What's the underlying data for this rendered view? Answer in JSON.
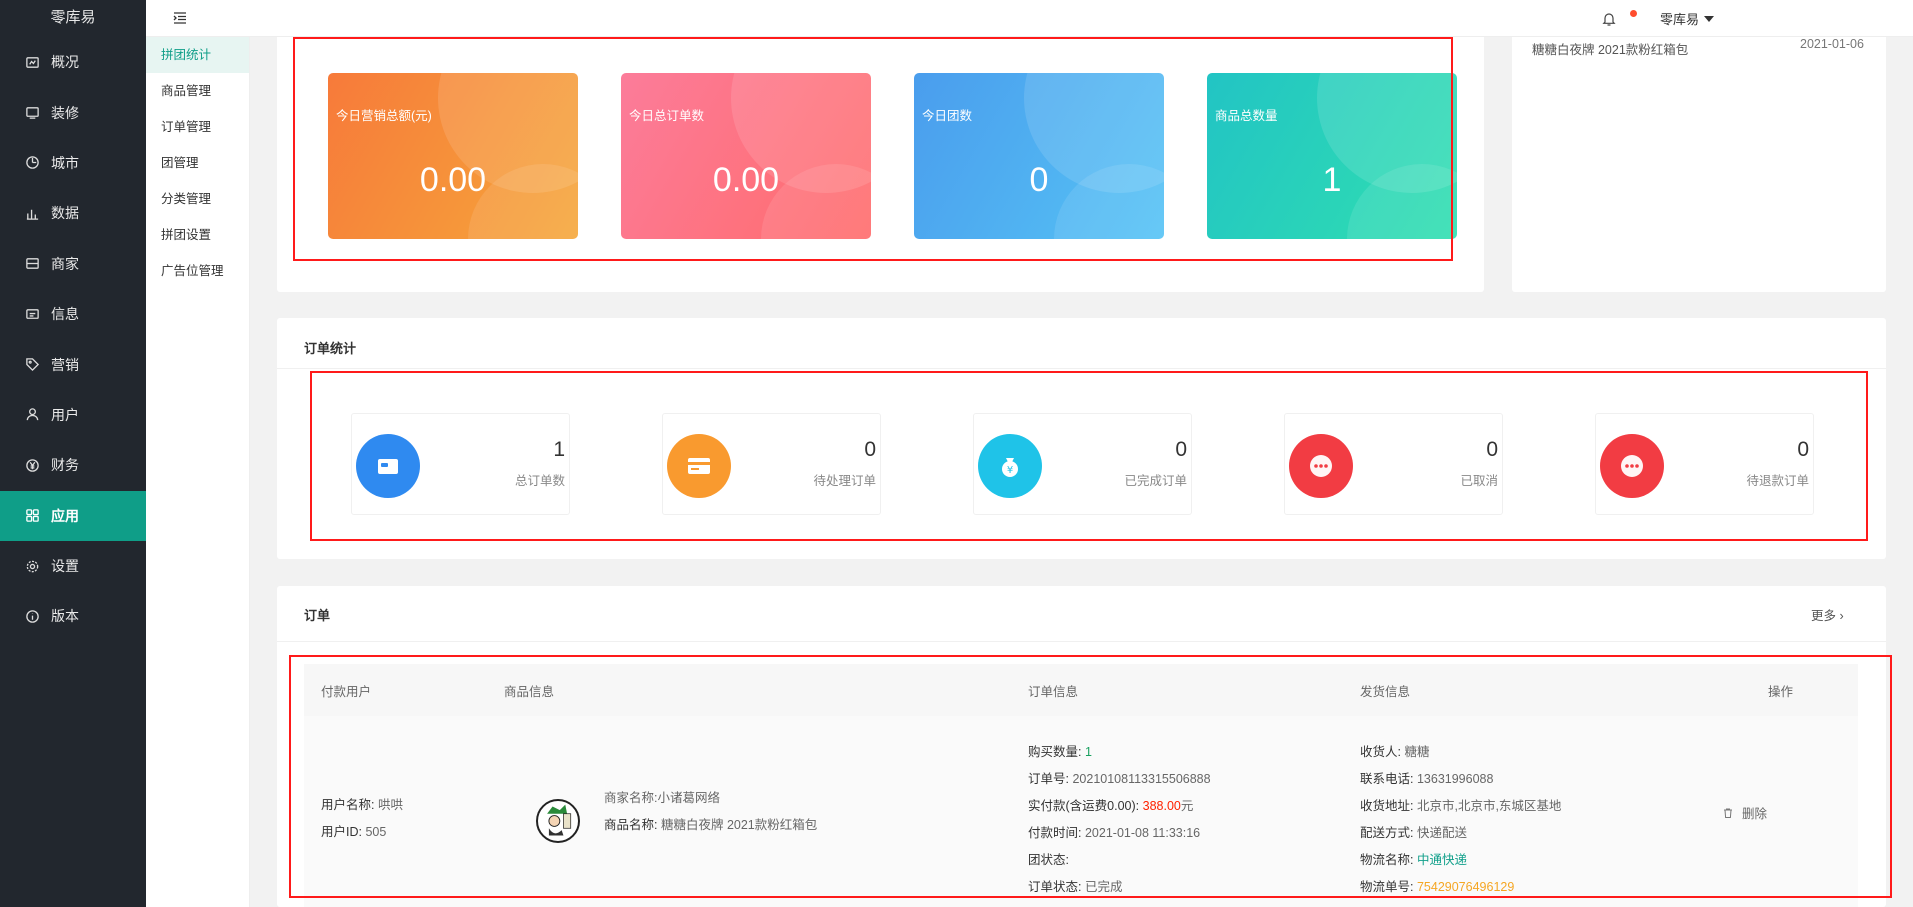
{
  "app": {
    "logo": "零库易"
  },
  "sidebar": {
    "items": [
      {
        "label": "概况",
        "icon": "dashboard-icon",
        "active": false
      },
      {
        "label": "装修",
        "icon": "decor-icon",
        "active": false
      },
      {
        "label": "城市",
        "icon": "city-icon",
        "active": false
      },
      {
        "label": "数据",
        "icon": "bar-chart-icon",
        "active": false
      },
      {
        "label": "商家",
        "icon": "shop-icon",
        "active": false
      },
      {
        "label": "信息",
        "icon": "message-icon",
        "active": false
      },
      {
        "label": "营销",
        "icon": "tag-icon",
        "active": false
      },
      {
        "label": "用户",
        "icon": "user-icon",
        "active": false
      },
      {
        "label": "财务",
        "icon": "yen-icon",
        "active": false
      },
      {
        "label": "应用",
        "icon": "apps-icon",
        "active": true
      },
      {
        "label": "设置",
        "icon": "gear-icon",
        "active": false
      },
      {
        "label": "版本",
        "icon": "info-icon",
        "active": false
      }
    ]
  },
  "subnav": {
    "items": [
      {
        "label": "拼团统计",
        "active": true
      },
      {
        "label": "商品管理",
        "active": false
      },
      {
        "label": "订单管理",
        "active": false
      },
      {
        "label": "团管理",
        "active": false
      },
      {
        "label": "分类管理",
        "active": false
      },
      {
        "label": "拼团设置",
        "active": false
      },
      {
        "label": "广告位管理",
        "active": false
      }
    ]
  },
  "topbar": {
    "user_name": "零库易",
    "notification_dot": true
  },
  "side_panel": {
    "item_title": "糖糖白夜牌 2021款粉红箱包",
    "item_date": "2021-01-06"
  },
  "stats": [
    {
      "label": "今日营销总额(元)",
      "value": "0.00",
      "gradient": [
        "#f77a3a",
        "#f5a73a"
      ]
    },
    {
      "label": "今日总订单数",
      "value": "0.00",
      "gradient": [
        "#fc7c9a",
        "#ff6b6b"
      ]
    },
    {
      "label": "今日团数",
      "value": "0",
      "gradient": [
        "#4a9ded",
        "#55c3f5"
      ]
    },
    {
      "label": "商品总数量",
      "value": "1",
      "gradient": [
        "#22c4c4",
        "#30dfb0"
      ]
    }
  ],
  "order_stats": {
    "title": "订单统计",
    "items": [
      {
        "value": "1",
        "label": "总订单数",
        "icon": "wallet-icon",
        "color": "#2f8af0"
      },
      {
        "value": "0",
        "label": "待处理订单",
        "icon": "card-icon",
        "color": "#f99a2f"
      },
      {
        "value": "0",
        "label": "已完成订单",
        "icon": "money-bag-icon",
        "color": "#1fc3e8"
      },
      {
        "value": "0",
        "label": "已取消",
        "icon": "more-dots-icon",
        "color": "#f23c43"
      },
      {
        "value": "0",
        "label": "待退款订单",
        "icon": "more-dots-icon",
        "color": "#f23c43"
      }
    ]
  },
  "orders": {
    "title": "订单",
    "more": "更多",
    "headers": {
      "user": "付款用户",
      "product": "商品信息",
      "order": "订单信息",
      "shipping": "发货信息",
      "action": "操作"
    },
    "row": {
      "user_name_label": "用户名称:",
      "user_name": "哄哄",
      "user_id_label": "用户ID:",
      "user_id": "505",
      "merchant_label": "商家名称:",
      "merchant": "小诸葛网络",
      "product_label": "商品名称:",
      "product": "糖糖白夜牌 2021款粉红箱包",
      "qty_label": "购买数量:",
      "qty": "1",
      "order_no_label": "订单号:",
      "order_no": "20210108113315506888",
      "paid_label": "实付款(含运费0.00):",
      "paid": "388.00",
      "paid_unit": "元",
      "pay_time_label": "付款时间:",
      "pay_time": "2021-01-08 11:33:16",
      "group_status_label": "团状态:",
      "group_status": "",
      "order_status_label": "订单状态:",
      "order_status": "已完成",
      "receiver_label": "收货人:",
      "receiver": "糖糖",
      "phone_label": "联系电话:",
      "phone": "13631996088",
      "address_label": "收货地址:",
      "address": "北京市,北京市,东城区基地",
      "delivery_label": "配送方式:",
      "delivery": "快递配送",
      "logistics_label": "物流名称:",
      "logistics": "中通快递",
      "tracking_label": "物流单号:",
      "tracking": "75429076496129",
      "delete": "删除"
    }
  }
}
